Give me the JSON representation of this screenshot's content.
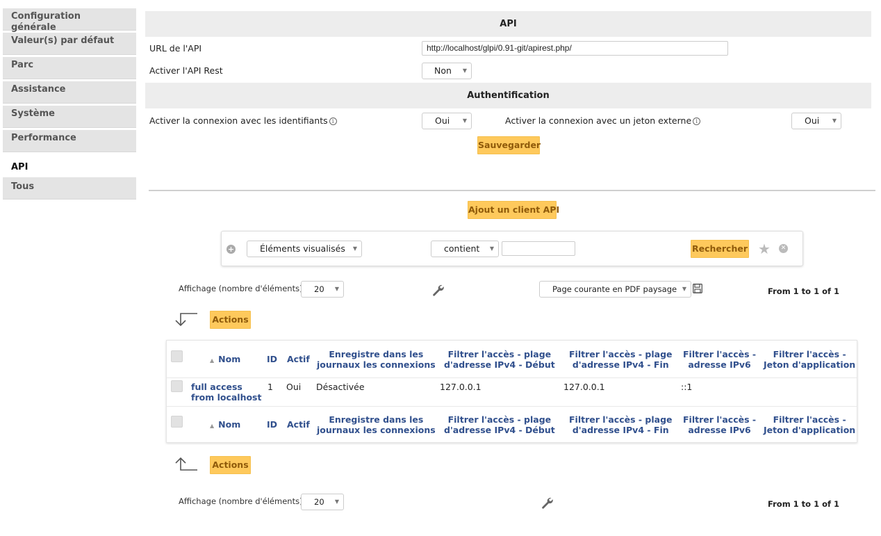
{
  "sidebar": {
    "items": [
      {
        "label": "Configuration générale"
      },
      {
        "label": "Valeur(s) par défaut"
      },
      {
        "label": "Parc"
      },
      {
        "label": "Assistance"
      },
      {
        "label": "Système"
      },
      {
        "label": "Performance"
      },
      {
        "label": "API",
        "active": true
      },
      {
        "label": "Tous"
      }
    ]
  },
  "api_section": {
    "title": "API",
    "url_label": "URL de l'API",
    "url_value": "http://localhost/glpi/0.91-git/apirest.php/",
    "rest_label": "Activer l'API Rest",
    "rest_value": "Non"
  },
  "auth_section": {
    "title": "Authentification",
    "credentials_label": "Activer la connexion avec les identifiants",
    "credentials_value": "Oui",
    "token_label": "Activer la connexion avec un jeton externe",
    "token_value": "Oui",
    "save_label": "Sauvegarder"
  },
  "add_client_label": "Ajout un client API",
  "search": {
    "field_value": "Éléments visualisés",
    "operator_value": "contient",
    "text_value": "",
    "search_label": "Rechercher"
  },
  "pager_top": {
    "display_label": "Affichage (nombre d'éléments)",
    "per_page": "20",
    "export_value": "Page courante en PDF paysage",
    "count_text": "From 1 to 1 of 1"
  },
  "actions_label": "Actions",
  "table": {
    "columns": [
      "Nom",
      "ID",
      "Actif",
      "Enregistre dans les\njournaux les connexions",
      "Filtrer l'accès - plage\nd'adresse IPv4 - Début",
      "Filtrer l'accès - plage\nd'adresse IPv4 - Fin",
      "Filtrer l'accès -\nadresse IPv6",
      "Filtrer l'accès -\nJeton d'application"
    ],
    "rows": [
      {
        "name": "full access\nfrom localhost",
        "id": "1",
        "active": "Oui",
        "log": "Désactivée",
        "ipv4_start": "127.0.0.1",
        "ipv4_end": "127.0.0.1",
        "ipv6": "::1",
        "token": ""
      }
    ]
  },
  "pager_bottom": {
    "display_label": "Affichage (nombre d'éléments)",
    "per_page": "20",
    "count_text": "From 1 to 1 of 1"
  },
  "icons": {
    "wrench": "wrench-icon",
    "floppy": "save-icon",
    "star": "bookmark-star-icon",
    "reset": "reset-icon",
    "add": "add-criterion-icon",
    "info": "info-icon",
    "sort": "sort-asc-icon"
  },
  "colors": {
    "accent": "#fec95c",
    "link": "#31508d",
    "header_bg": "#ededed"
  }
}
